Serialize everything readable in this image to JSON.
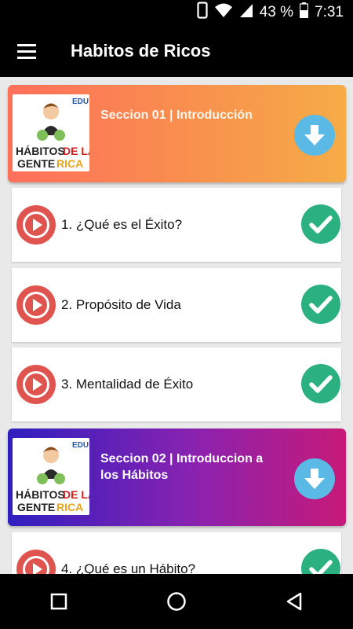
{
  "status_bar": {
    "battery_percent": "43 %",
    "time": "7:31",
    "icons": [
      "vibrate-icon",
      "wifi-icon",
      "signal-icon",
      "battery-icon"
    ]
  },
  "app_bar": {
    "title": "Habitos de Ricos",
    "menu_icon": "hamburger-menu-icon"
  },
  "thumbnail": {
    "badge": "EDU",
    "line1a": "HÁBITOS",
    "line1b": "DE LA",
    "line2a": "GENTE",
    "line2b": "RICA"
  },
  "sections": [
    {
      "title": "Seccion 01 | Introducción",
      "icon": "download-arrow-icon"
    },
    {
      "title": "Seccion 02 | Introduccion a los Hábitos",
      "icon": "download-arrow-icon"
    }
  ],
  "lessons": [
    {
      "label": "1. ¿Qué es el Éxito?",
      "completed": true
    },
    {
      "label": "2. Propósito de Vida",
      "completed": true
    },
    {
      "label": "3. Mentalidad de Éxito",
      "completed": true
    },
    {
      "label": "4. ¿Qué es un Hábito?",
      "completed": true
    }
  ],
  "colors": {
    "play_red": "#e05450",
    "check_green": "#2bb07f",
    "download_blue": "#5bb9e6"
  },
  "nav_bar": [
    "recents-square-icon",
    "home-circle-icon",
    "back-triangle-icon"
  ]
}
